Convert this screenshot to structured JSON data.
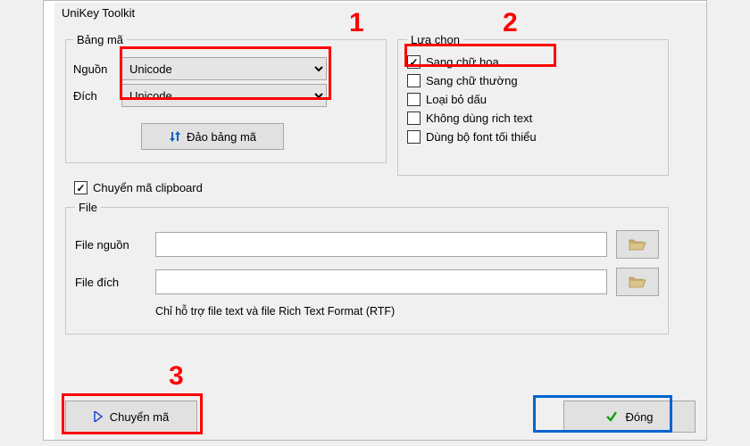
{
  "window_title": "UniKey Toolkit",
  "bangma": {
    "legend": "Bảng mã",
    "nguon_label": "Nguồn",
    "nguon_value": "Unicode",
    "dich_label": "Đích",
    "dich_value": "Unicode",
    "dao_button": "Đảo bảng mã"
  },
  "luachon": {
    "legend": "Lựa chọn",
    "items": [
      {
        "label": "Sang chữ hoa",
        "checked": true
      },
      {
        "label": "Sang chữ thường",
        "checked": false
      },
      {
        "label": "Loại bỏ dấu",
        "checked": false
      },
      {
        "label": "Không dùng rich text",
        "checked": false
      },
      {
        "label": "Dùng bộ font tối thiểu",
        "checked": false
      }
    ]
  },
  "clipboard": {
    "label": "Chuyển mã clipboard",
    "checked": true
  },
  "file": {
    "legend": "File",
    "nguon_label": "File nguồn",
    "nguon_value": "",
    "dich_label": "File đích",
    "dich_value": "",
    "hint": "Chỉ hỗ trợ file text và file Rich Text Format (RTF)"
  },
  "buttons": {
    "convert": "Chuyển mã",
    "close": "Đóng"
  },
  "annotations": {
    "n1": "1",
    "n2": "2",
    "n3": "3"
  }
}
